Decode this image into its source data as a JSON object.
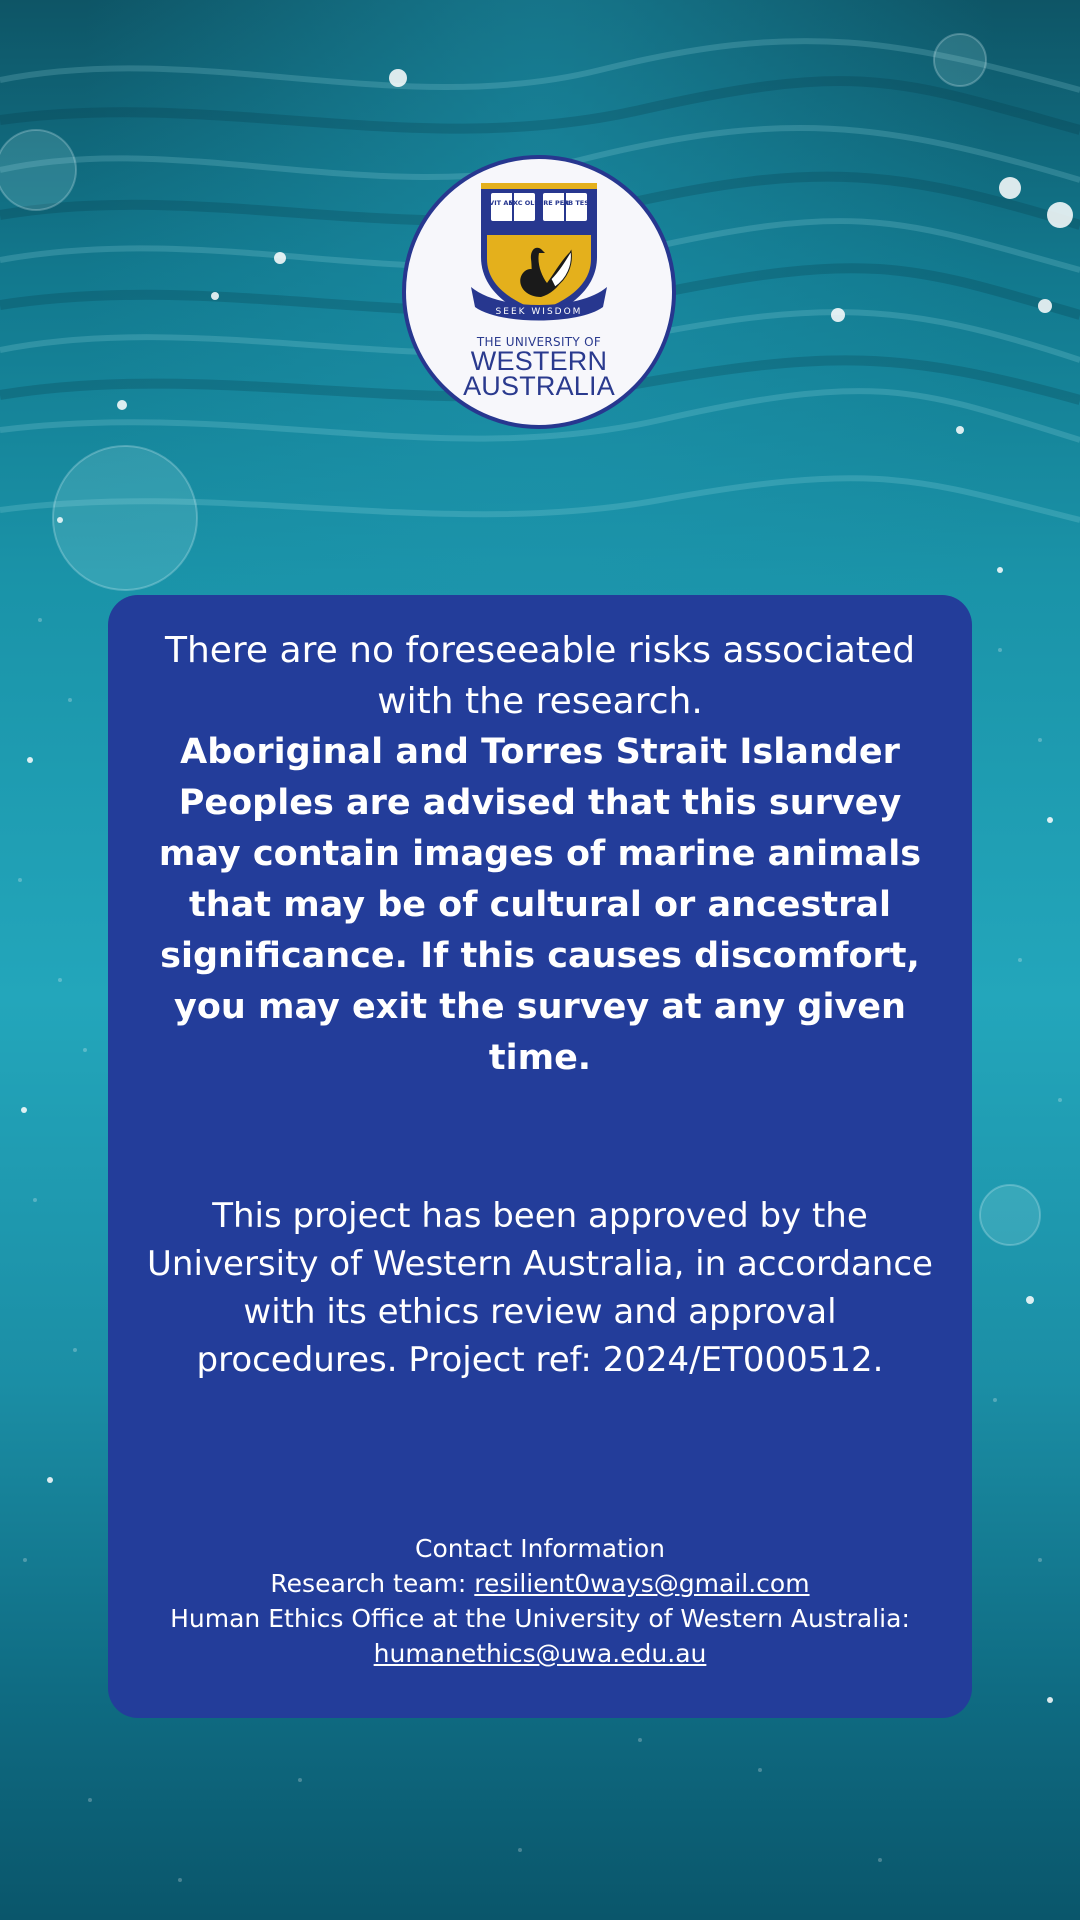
{
  "logo": {
    "shield_books": [
      "VIT AM",
      "EXC OLU",
      "ERE PER",
      "AB TES"
    ],
    "motto": "SEEK WISDOM",
    "name_small": "THE UNIVERSITY OF",
    "name_line1": "WESTERN",
    "name_line2": "AUSTRALIA",
    "colors": {
      "navy": "#27378f",
      "gold": "#e4b01c",
      "badge": "#f7f7fb"
    }
  },
  "panel": {
    "background": "#233d9a",
    "risk_text": "There are no foreseeable risks associated with the research.",
    "advisory_text": "Aboriginal and Torres Strait Islander Peoples are advised that this survey may contain images of marine animals that may be of cultural or ancestral significance. If this causes discomfort, you may exit the survey at any given time.",
    "approval_text": "This project has been approved by the University of Western Australia, in accordance with its ethics review and approval procedures. Project ref: 2024/ET000512.",
    "contact": {
      "heading": "Contact Information",
      "research_label": "Research team:",
      "research_email": "resilient0ways@gmail.com",
      "ethics_label": "Human Ethics Office at the University of Western Australia:",
      "ethics_email": "humanethics@uwa.edu.au"
    }
  }
}
